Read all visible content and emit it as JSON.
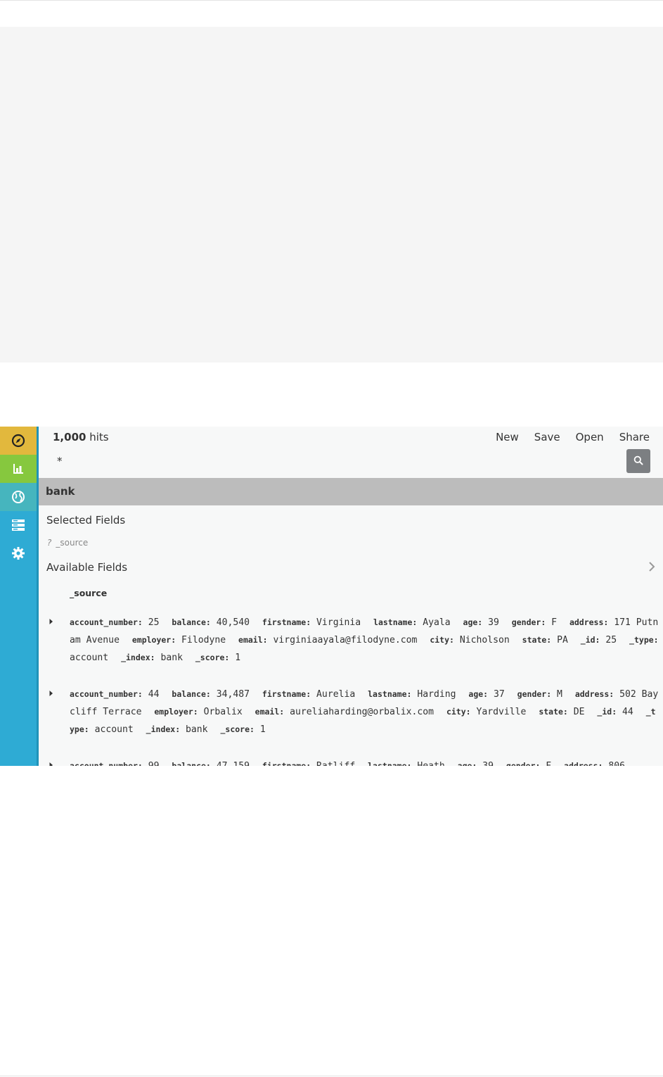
{
  "app": {
    "hits": {
      "count": "1,000",
      "label": "hits"
    },
    "menu": [
      "New",
      "Save",
      "Open",
      "Share"
    ],
    "query": "*",
    "index_name": "bank",
    "selected_fields_title": "Selected Fields",
    "selected_field": {
      "type_glyph": "?",
      "name": "_source"
    },
    "available_fields_title": "Available Fields",
    "column_header": "_source",
    "sidebar_items": [
      {
        "name": "discover-icon",
        "color": "#e2b83d"
      },
      {
        "name": "visualize-icon",
        "color": "#86c83e"
      },
      {
        "name": "dashboard-icon",
        "color": "#46b5be"
      },
      {
        "name": "timelion-icon",
        "color": "#2eabd4"
      },
      {
        "name": "settings-icon",
        "color": "#2eabd4"
      }
    ]
  },
  "documents": [
    {
      "fields": [
        {
          "key": "account_number:",
          "value": "25"
        },
        {
          "key": "balance:",
          "value": "40,540"
        },
        {
          "key": "firstname:",
          "value": "Virginia"
        },
        {
          "key": "lastname:",
          "value": "Ayala"
        },
        {
          "key": "age:",
          "value": "39"
        },
        {
          "key": "gender:",
          "value": "F"
        },
        {
          "key": "address:",
          "value": "171 Putnam Avenue"
        },
        {
          "key": "employer:",
          "value": "Filodyne"
        },
        {
          "key": "email:",
          "value": "virginiaayala@filodyne.com"
        },
        {
          "key": "city:",
          "value": "Nicholson"
        },
        {
          "key": "state:",
          "value": "PA"
        },
        {
          "key": "_id:",
          "value": "25"
        },
        {
          "key": "_type:",
          "value": "account"
        },
        {
          "key": "_index:",
          "value": "bank"
        },
        {
          "key": "_score:",
          "value": "1"
        }
      ]
    },
    {
      "fields": [
        {
          "key": "account_number:",
          "value": "44"
        },
        {
          "key": "balance:",
          "value": "34,487"
        },
        {
          "key": "firstname:",
          "value": "Aurelia"
        },
        {
          "key": "lastname:",
          "value": "Harding"
        },
        {
          "key": "age:",
          "value": "37"
        },
        {
          "key": "gender:",
          "value": "M"
        },
        {
          "key": "address:",
          "value": "502 Baycliff Terrace"
        },
        {
          "key": "employer:",
          "value": "Orbalix"
        },
        {
          "key": "email:",
          "value": "aureliaharding@orbalix.com"
        },
        {
          "key": "city:",
          "value": "Yardville"
        },
        {
          "key": "state:",
          "value": "DE"
        },
        {
          "key": "_id:",
          "value": "44"
        },
        {
          "key": "_type:",
          "value": "account"
        },
        {
          "key": "_index:",
          "value": "bank"
        },
        {
          "key": "_score:",
          "value": "1"
        }
      ]
    },
    {
      "fields": [
        {
          "key": "account_number:",
          "value": "99"
        },
        {
          "key": "balance:",
          "value": "47,159"
        },
        {
          "key": "firstname:",
          "value": "Ratliff"
        },
        {
          "key": "lastname:",
          "value": "Heath"
        },
        {
          "key": "age:",
          "value": "39"
        },
        {
          "key": "gender:",
          "value": "F"
        },
        {
          "key": "address:",
          "value": "806"
        }
      ]
    }
  ]
}
